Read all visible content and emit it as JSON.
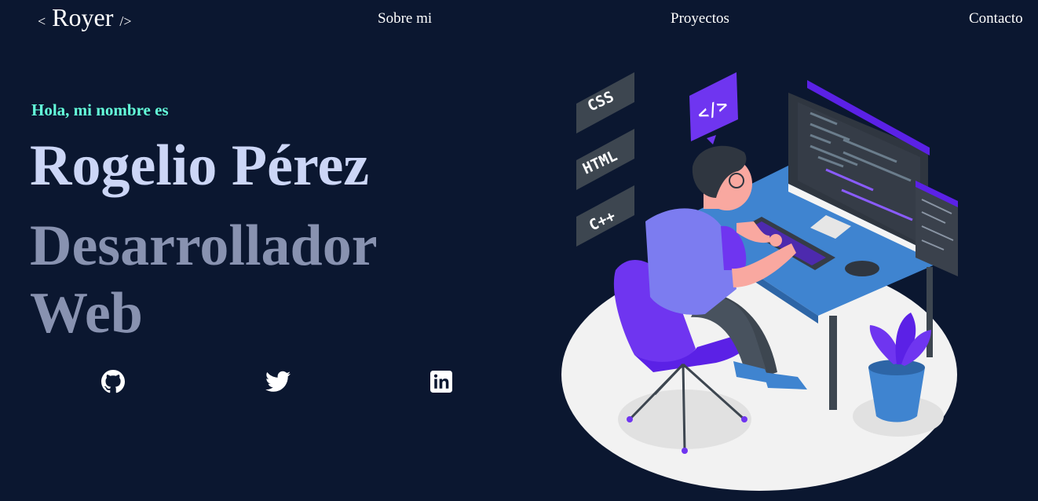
{
  "nav": {
    "logo_open": "<",
    "logo_text": "Royer",
    "logo_close": "/>",
    "links": [
      "Sobre mi",
      "Proyectos",
      "Contacto"
    ]
  },
  "hero": {
    "greeting": "Hola, mi nombre es",
    "name": "Rogelio Pérez",
    "role": "Desarrollador Web"
  },
  "illustration": {
    "tags": [
      "CSS",
      "HTML",
      "C++"
    ],
    "bubble": "</>"
  },
  "social": [
    "github-icon",
    "twitter-icon",
    "linkedin-icon"
  ],
  "colors": {
    "background": "#0b1730",
    "accent": "#64ffda",
    "name": "#ccd6f6",
    "role": "#8892b0",
    "purple": "#5b21e6"
  }
}
